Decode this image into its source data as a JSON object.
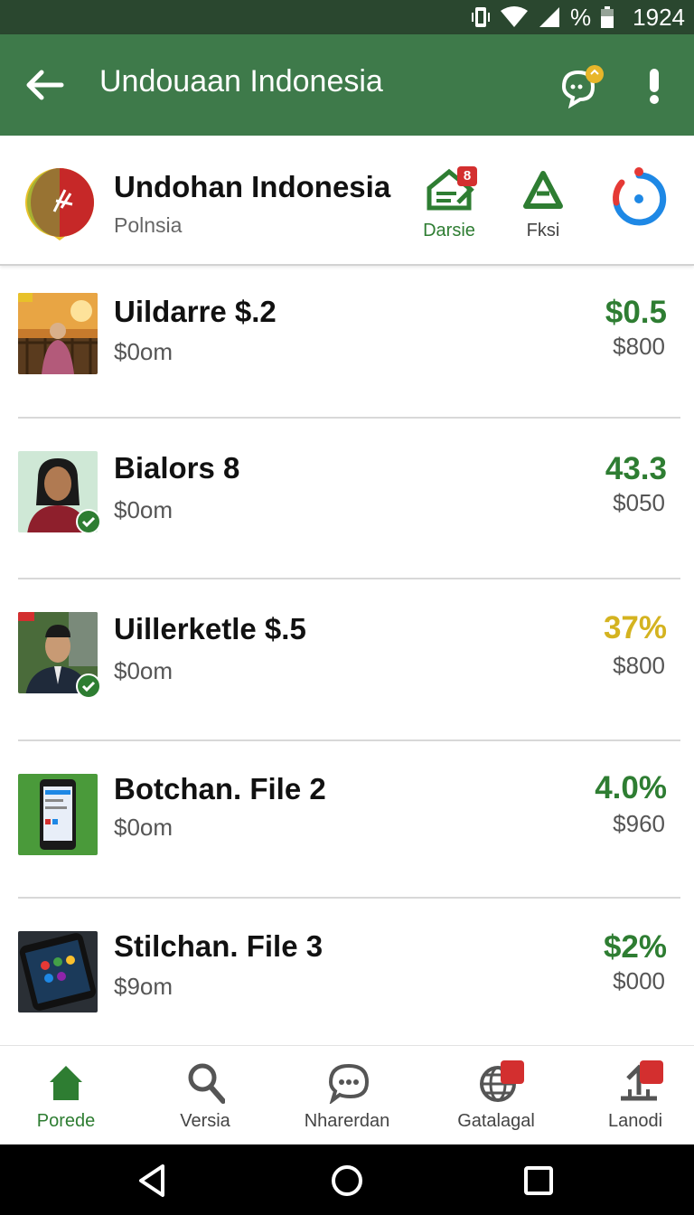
{
  "status_bar": {
    "percent": "%",
    "time": "1924"
  },
  "app_bar": {
    "title": "Undouaan Indonesia"
  },
  "profile": {
    "name": "Undohan Indonesia",
    "subtitle": "Polnsia",
    "actions": [
      {
        "label": "Darsie",
        "badge": "8",
        "icon": "pencil-house-icon"
      },
      {
        "label": "Fksi",
        "icon": "triangle-icon"
      },
      {
        "label": "",
        "icon": "refresh-ring-icon"
      }
    ]
  },
  "items": [
    {
      "title": "Uildarre $.2",
      "sub": "$0om",
      "value": "$0.5",
      "price": "$800",
      "value_color": "#2e7d32"
    },
    {
      "title": "Bialors 8",
      "sub": "$0om",
      "value": "43.3",
      "price": "$050",
      "value_color": "#2e7d32"
    },
    {
      "title": "Uillerketle $.5",
      "sub": "$0om",
      "value": "37%",
      "price": "$800",
      "value_color": "#d4b320"
    },
    {
      "title": "Botchan. File 2",
      "sub": "$0om",
      "value": "4.0%",
      "price": "$960",
      "value_color": "#2e7d32"
    },
    {
      "title": "Stilchan. File 3",
      "sub": "$9om",
      "value": "$2%",
      "price": "$000",
      "value_color": "#2e7d32"
    }
  ],
  "bottom_nav": [
    {
      "label": "Porede",
      "icon": "home-icon",
      "active": true
    },
    {
      "label": "Versia",
      "icon": "search-icon"
    },
    {
      "label": "Nharerdan",
      "icon": "chat-icon"
    },
    {
      "label": "Gatalagal",
      "icon": "globe-icon"
    },
    {
      "label": "Lanodi",
      "icon": "upload-icon"
    }
  ],
  "colors": {
    "appbar": "#3e7a4a",
    "statusbar": "#2a472f",
    "accent_green": "#2e7d32",
    "badge_red": "#d32f2f"
  }
}
